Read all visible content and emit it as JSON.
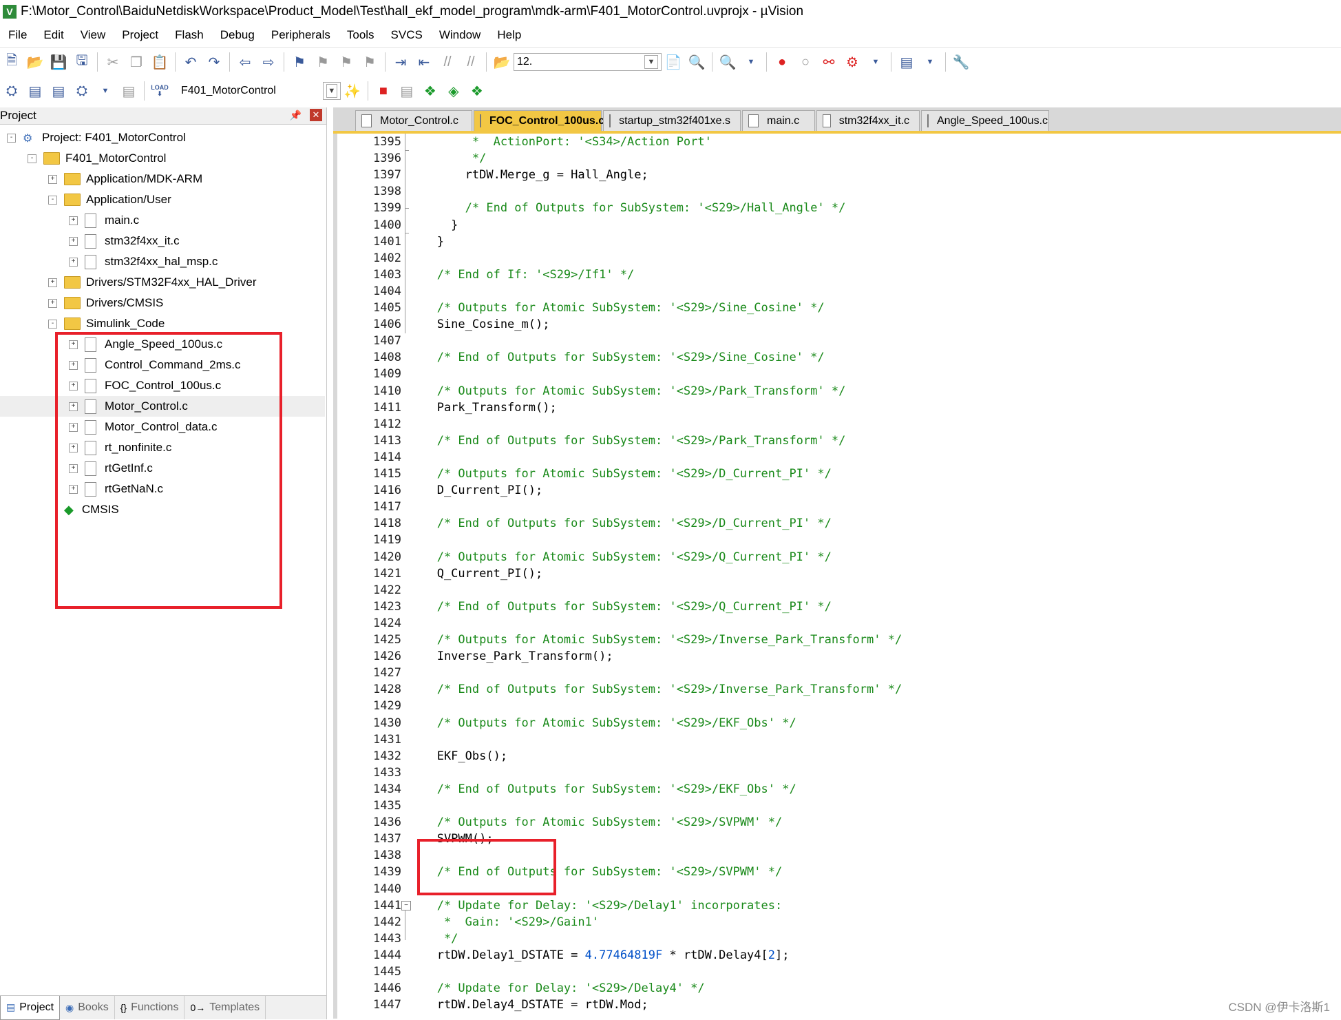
{
  "window": {
    "title": "F:\\Motor_Control\\BaiduNetdiskWorkspace\\Product_Model\\Test\\hall_ekf_model_program\\mdk-arm\\F401_MotorControl.uvprojx - µVision",
    "icon": "V"
  },
  "menu": [
    "File",
    "Edit",
    "View",
    "Project",
    "Flash",
    "Debug",
    "Peripherals",
    "Tools",
    "SVCS",
    "Window",
    "Help"
  ],
  "toolbar": {
    "find_text": "12.",
    "target_name": "F401_MotorControl",
    "load_label": "LOAD"
  },
  "project_panel": {
    "title": "Project",
    "tree": [
      {
        "label": "Project: F401_MotorControl",
        "kind": "project",
        "depth": 0,
        "exp": "-"
      },
      {
        "label": "F401_MotorControl",
        "kind": "folder",
        "depth": 1,
        "exp": "-"
      },
      {
        "label": "Application/MDK-ARM",
        "kind": "folder",
        "depth": 2,
        "exp": "+"
      },
      {
        "label": "Application/User",
        "kind": "folder",
        "depth": 2,
        "exp": "-"
      },
      {
        "label": "main.c",
        "kind": "file",
        "depth": 3,
        "exp": "+"
      },
      {
        "label": "stm32f4xx_it.c",
        "kind": "file",
        "depth": 3,
        "exp": "+"
      },
      {
        "label": "stm32f4xx_hal_msp.c",
        "kind": "file",
        "depth": 3,
        "exp": "+"
      },
      {
        "label": "Drivers/STM32F4xx_HAL_Driver",
        "kind": "folder",
        "depth": 2,
        "exp": "+"
      },
      {
        "label": "Drivers/CMSIS",
        "kind": "folder",
        "depth": 2,
        "exp": "+"
      },
      {
        "label": "Simulink_Code",
        "kind": "folder",
        "depth": 2,
        "exp": "-"
      },
      {
        "label": "Angle_Speed_100us.c",
        "kind": "file",
        "depth": 3,
        "exp": "+"
      },
      {
        "label": "Control_Command_2ms.c",
        "kind": "file",
        "depth": 3,
        "exp": "+"
      },
      {
        "label": "FOC_Control_100us.c",
        "kind": "file",
        "depth": 3,
        "exp": "+"
      },
      {
        "label": "Motor_Control.c",
        "kind": "file",
        "depth": 3,
        "exp": "+",
        "selected": true
      },
      {
        "label": "Motor_Control_data.c",
        "kind": "file",
        "depth": 3,
        "exp": "+"
      },
      {
        "label": "rt_nonfinite.c",
        "kind": "file",
        "depth": 3,
        "exp": "+"
      },
      {
        "label": "rtGetInf.c",
        "kind": "file",
        "depth": 3,
        "exp": "+"
      },
      {
        "label": "rtGetNaN.c",
        "kind": "file",
        "depth": 3,
        "exp": "+"
      },
      {
        "label": "CMSIS",
        "kind": "cmsis",
        "depth": 2,
        "exp": ""
      }
    ],
    "tabs": [
      {
        "label": "Project",
        "icon": "▤",
        "active": true
      },
      {
        "label": "Books",
        "icon": "◉",
        "active": false
      },
      {
        "label": "Functions",
        "icon": "{}",
        "active": false
      },
      {
        "label": "Templates",
        "icon": "0→",
        "active": false
      }
    ]
  },
  "editor": {
    "tabs": [
      {
        "label": "Motor_Control.c",
        "active": false
      },
      {
        "label": "FOC_Control_100us.c",
        "active": true
      },
      {
        "label": "startup_stm32f401xe.s",
        "active": false
      },
      {
        "label": "main.c",
        "active": false
      },
      {
        "label": "stm32f4xx_it.c",
        "active": false
      },
      {
        "label": "Angle_Speed_100us.c",
        "active": false
      }
    ],
    "lines": [
      {
        "n": "1395",
        "segs": [
          [
            "c",
            "        *  ActionPort: '<S34>/Action Port'"
          ]
        ]
      },
      {
        "n": "1396",
        "segs": [
          [
            "c",
            "        */"
          ]
        ]
      },
      {
        "n": "1397",
        "segs": [
          [
            "t",
            "       rtDW.Merge_g = Hall_Angle;"
          ]
        ]
      },
      {
        "n": "1398",
        "segs": []
      },
      {
        "n": "1399",
        "segs": [
          [
            "c",
            "       /* End of Outputs for SubSystem: '<S29>/Hall_Angle' */"
          ]
        ]
      },
      {
        "n": "1400",
        "segs": [
          [
            "t",
            "     }"
          ]
        ]
      },
      {
        "n": "1401",
        "segs": [
          [
            "t",
            "   }"
          ]
        ]
      },
      {
        "n": "1402",
        "segs": []
      },
      {
        "n": "1403",
        "segs": [
          [
            "c",
            "   /* End of If: '<S29>/If1' */"
          ]
        ]
      },
      {
        "n": "1404",
        "segs": []
      },
      {
        "n": "1405",
        "segs": [
          [
            "c",
            "   /* Outputs for Atomic SubSystem: '<S29>/Sine_Cosine' */"
          ]
        ]
      },
      {
        "n": "1406",
        "segs": [
          [
            "t",
            "   Sine_Cosine_m();"
          ]
        ]
      },
      {
        "n": "1407",
        "segs": []
      },
      {
        "n": "1408",
        "segs": [
          [
            "c",
            "   /* End of Outputs for SubSystem: '<S29>/Sine_Cosine' */"
          ]
        ]
      },
      {
        "n": "1409",
        "segs": []
      },
      {
        "n": "1410",
        "segs": [
          [
            "c",
            "   /* Outputs for Atomic SubSystem: '<S29>/Park_Transform' */"
          ]
        ]
      },
      {
        "n": "1411",
        "segs": [
          [
            "t",
            "   Park_Transform();"
          ]
        ]
      },
      {
        "n": "1412",
        "segs": []
      },
      {
        "n": "1413",
        "segs": [
          [
            "c",
            "   /* End of Outputs for SubSystem: '<S29>/Park_Transform' */"
          ]
        ]
      },
      {
        "n": "1414",
        "segs": []
      },
      {
        "n": "1415",
        "segs": [
          [
            "c",
            "   /* Outputs for Atomic SubSystem: '<S29>/D_Current_PI' */"
          ]
        ]
      },
      {
        "n": "1416",
        "segs": [
          [
            "t",
            "   D_Current_PI();"
          ]
        ]
      },
      {
        "n": "1417",
        "segs": []
      },
      {
        "n": "1418",
        "segs": [
          [
            "c",
            "   /* End of Outputs for SubSystem: '<S29>/D_Current_PI' */"
          ]
        ]
      },
      {
        "n": "1419",
        "segs": []
      },
      {
        "n": "1420",
        "segs": [
          [
            "c",
            "   /* Outputs for Atomic SubSystem: '<S29>/Q_Current_PI' */"
          ]
        ]
      },
      {
        "n": "1421",
        "segs": [
          [
            "t",
            "   Q_Current_PI();"
          ]
        ]
      },
      {
        "n": "1422",
        "segs": []
      },
      {
        "n": "1423",
        "segs": [
          [
            "c",
            "   /* End of Outputs for SubSystem: '<S29>/Q_Current_PI' */"
          ]
        ]
      },
      {
        "n": "1424",
        "segs": []
      },
      {
        "n": "1425",
        "segs": [
          [
            "c",
            "   /* Outputs for Atomic SubSystem: '<S29>/Inverse_Park_Transform' */"
          ]
        ]
      },
      {
        "n": "1426",
        "segs": [
          [
            "t",
            "   Inverse_Park_Transform();"
          ]
        ]
      },
      {
        "n": "1427",
        "segs": []
      },
      {
        "n": "1428",
        "segs": [
          [
            "c",
            "   /* End of Outputs for SubSystem: '<S29>/Inverse_Park_Transform' */"
          ]
        ]
      },
      {
        "n": "1429",
        "segs": []
      },
      {
        "n": "1430",
        "segs": [
          [
            "c",
            "   /* Outputs for Atomic SubSystem: '<S29>/EKF_Obs' */"
          ]
        ]
      },
      {
        "n": "1431",
        "segs": []
      },
      {
        "n": "1432",
        "segs": [
          [
            "t",
            "   EKF_Obs();"
          ]
        ]
      },
      {
        "n": "1433",
        "segs": []
      },
      {
        "n": "1434",
        "segs": [
          [
            "c",
            "   /* End of Outputs for SubSystem: '<S29>/EKF_Obs' */"
          ]
        ]
      },
      {
        "n": "1435",
        "segs": []
      },
      {
        "n": "1436",
        "segs": [
          [
            "c",
            "   /* Outputs for Atomic SubSystem: '<S29>/SVPWM' */"
          ]
        ]
      },
      {
        "n": "1437",
        "segs": [
          [
            "t",
            "   SVPWM();"
          ]
        ]
      },
      {
        "n": "1438",
        "segs": []
      },
      {
        "n": "1439",
        "segs": [
          [
            "c",
            "   /* End of Outputs for SubSystem: '<S29>/SVPWM' */"
          ]
        ]
      },
      {
        "n": "1440",
        "segs": []
      },
      {
        "n": "1441",
        "segs": [
          [
            "c",
            "   /* Update for Delay: '<S29>/Delay1' incorporates:"
          ]
        ]
      },
      {
        "n": "1442",
        "segs": [
          [
            "c",
            "    *  Gain: '<S29>/Gain1'"
          ]
        ]
      },
      {
        "n": "1443",
        "segs": [
          [
            "c",
            "    */"
          ]
        ]
      },
      {
        "n": "1444",
        "segs": [
          [
            "t",
            "   rtDW.Delay1_DSTATE = "
          ],
          [
            "n",
            "4.77464819F"
          ],
          [
            "t",
            " * rtDW.Delay4["
          ],
          [
            "n",
            "2"
          ],
          [
            "t",
            "];"
          ]
        ]
      },
      {
        "n": "1445",
        "segs": []
      },
      {
        "n": "1446",
        "segs": [
          [
            "c",
            "   /* Update for Delay: '<S29>/Delay4' */"
          ]
        ]
      },
      {
        "n": "1447",
        "segs": [
          [
            "t",
            "   rtDW.Delay4_DSTATE = rtDW.Mod;"
          ]
        ]
      }
    ]
  },
  "watermark": "CSDN @伊卡洛斯1",
  "colors": {
    "highlight": "#e8202a",
    "active_tab": "#f2c744",
    "comment": "#1a8a1a",
    "number": "#0050c8"
  }
}
